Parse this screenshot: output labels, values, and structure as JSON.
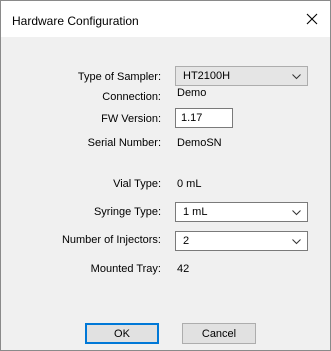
{
  "window": {
    "title": "Hardware Configuration"
  },
  "fields": {
    "type_of_sampler": {
      "label": "Type of Sampler:",
      "value": "HT2100H"
    },
    "connection": {
      "label": "Connection:",
      "value": "Demo"
    },
    "fw_version": {
      "label": "FW Version:",
      "value": "1.17"
    },
    "serial_number": {
      "label": "Serial Number:",
      "value": "DemoSN"
    },
    "vial_type": {
      "label": "Vial Type:",
      "value": "0 mL"
    },
    "syringe_type": {
      "label": "Syringe Type:",
      "value": "1 mL"
    },
    "number_of_injectors": {
      "label": "Number of Injectors:",
      "value": "2"
    },
    "mounted_tray": {
      "label": "Mounted Tray:",
      "value": "42"
    }
  },
  "buttons": {
    "ok": "OK",
    "cancel": "Cancel"
  },
  "icons": {
    "close": "close-icon",
    "dropdown": "chevron-down-icon"
  }
}
